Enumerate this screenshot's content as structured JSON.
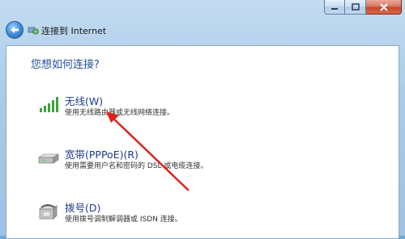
{
  "window": {
    "title": "连接到 Internet"
  },
  "content": {
    "question": "您想如何连接?",
    "options": [
      {
        "label": "无线(W)",
        "description": "使用无线路由器或无线网络连接。",
        "icon": "wireless-signal-icon"
      },
      {
        "label": "宽带(PPPoE)(R)",
        "description": "使用需要用户名和密码的 DSL 或电缆连接。",
        "icon": "broadband-modem-icon"
      },
      {
        "label": "拨号(D)",
        "description": "使用拨号调制解调器或 ISDN 连接。",
        "icon": "dialup-phone-icon"
      }
    ]
  },
  "colors": {
    "accent_text": "#1e3b8a",
    "annotation_arrow": "#e0201b",
    "close_button": "#c5472c"
  }
}
